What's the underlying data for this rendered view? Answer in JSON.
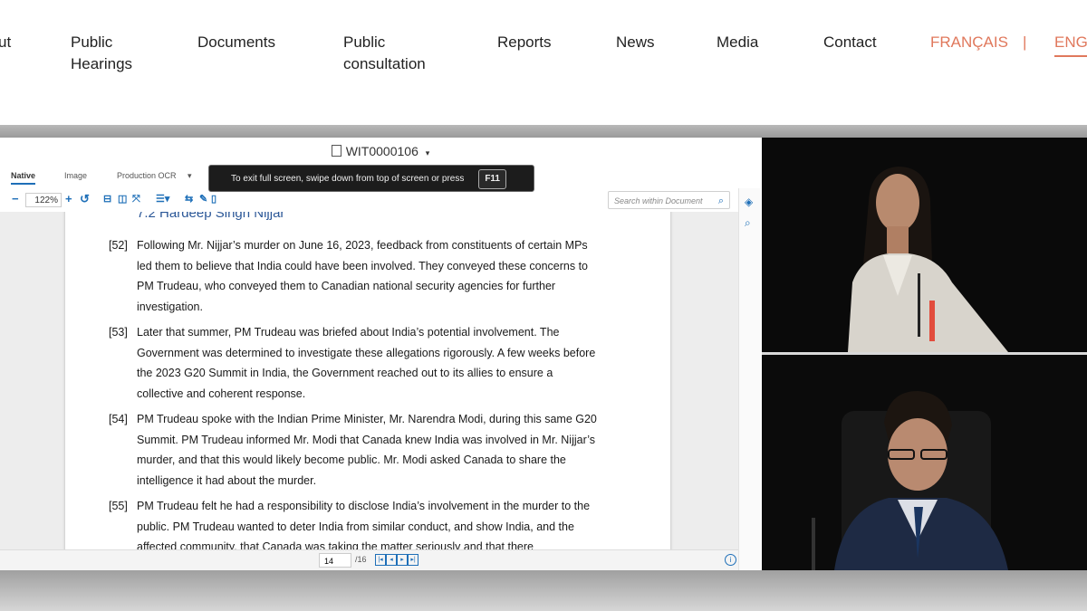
{
  "nav": {
    "items": [
      "ut",
      "Public Hearings",
      "Documents",
      "Public consultation",
      "Reports",
      "News",
      "Media",
      "Contact"
    ],
    "lang_fr": "FRANÇAIS",
    "separator": "|",
    "lang_en": "ENG",
    "accent": "#e0785c"
  },
  "viewer": {
    "doc_title": "WIT0000106",
    "tabs": [
      "Native",
      "Image",
      "Production OCR"
    ],
    "fullscreen_message": "To exit full screen, swipe down from top of screen or press",
    "fullscreen_key": "F11",
    "zoom": "122%",
    "search_placeholder": "Search within Document",
    "heading": "7.2 Hardeep Singh Nijjar",
    "paragraphs": [
      {
        "num": "[52]",
        "text": "Following Mr. Nijjar’s murder on June 16, 2023, feedback from constituents of certain MPs led them to believe that India could have been involved. They conveyed these concerns to PM Trudeau, who conveyed them to Canadian national security agencies for further investigation."
      },
      {
        "num": "[53]",
        "text": "Later that summer, PM Trudeau was briefed about India’s potential involvement. The Government was determined to investigate these allegations rigorously. A few weeks before the 2023 G20 Summit in India, the Government reached out to its allies to ensure a collective and coherent response."
      },
      {
        "num": "[54]",
        "text": "PM Trudeau spoke with the Indian Prime Minister, Mr. Narendra Modi, during this same G20 Summit. PM Trudeau informed Mr. Modi that Canada knew India was involved in Mr. Nijjar’s murder, and that this would likely become public. Mr. Modi asked Canada to share the intelligence it had about the murder."
      },
      {
        "num": "[55]",
        "text": "PM Trudeau felt he had a responsibility to disclose India’s involvement in the murder to the public. PM Trudeau wanted to deter India from similar conduct, and show India, and the affected community, that Canada was taking the matter seriously and that there"
      }
    ],
    "page_current": "14",
    "page_total": "/16",
    "link_color": "#1e6fb8"
  }
}
